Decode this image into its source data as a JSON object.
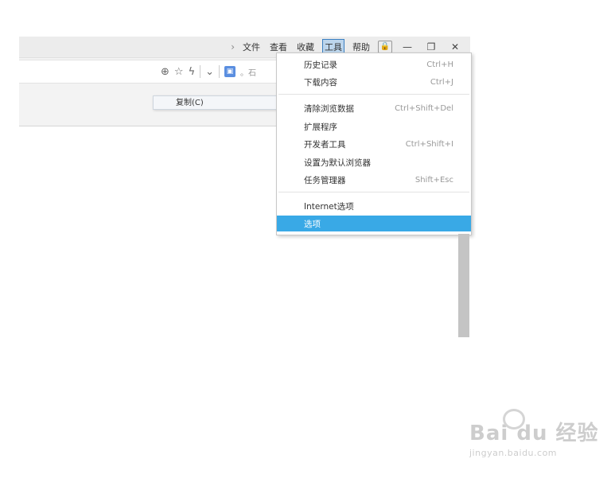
{
  "menu_bar": {
    "chevron": "›",
    "items": [
      "文件",
      "查看",
      "收藏",
      "工具",
      "帮助"
    ],
    "active_index": 3
  },
  "window_controls": {
    "lock": "🔒",
    "minimize": "—",
    "restore": "❐",
    "close": "✕"
  },
  "address_bar": {
    "icons": [
      "zoom-icon",
      "star-icon",
      "lightning-icon",
      "chevron-down-icon",
      "extension-icon"
    ],
    "zoom_glyph": "⊕",
    "star_glyph": "☆",
    "bolt_glyph": "ϟ",
    "chevron_glyph": "⌄",
    "ext_glyph": "▣",
    "clipped_text": "。石"
  },
  "context_menu": {
    "copy": "复制(C)"
  },
  "tools_menu": {
    "items": [
      {
        "label": "历史记录",
        "shortcut": "Ctrl+H"
      },
      {
        "label": "下载内容",
        "shortcut": "Ctrl+J"
      },
      {
        "label": "清除浏览数据",
        "shortcut": "Ctrl+Shift+Del"
      },
      {
        "label": "扩展程序",
        "shortcut": ""
      },
      {
        "label": "开发者工具",
        "shortcut": "Ctrl+Shift+I"
      },
      {
        "label": "设置为默认浏览器",
        "shortcut": ""
      },
      {
        "label": "任务管理器",
        "shortcut": "Shift+Esc"
      },
      {
        "label": "Internet选项",
        "shortcut": ""
      },
      {
        "label": "选项",
        "shortcut": "",
        "highlighted": true
      }
    ]
  },
  "watermark": {
    "logo": "Bai du 经验",
    "url": "jingyan.baidu.com"
  },
  "colors": {
    "highlight": "#39a9e6",
    "active_menu": "#bcd5ec"
  }
}
